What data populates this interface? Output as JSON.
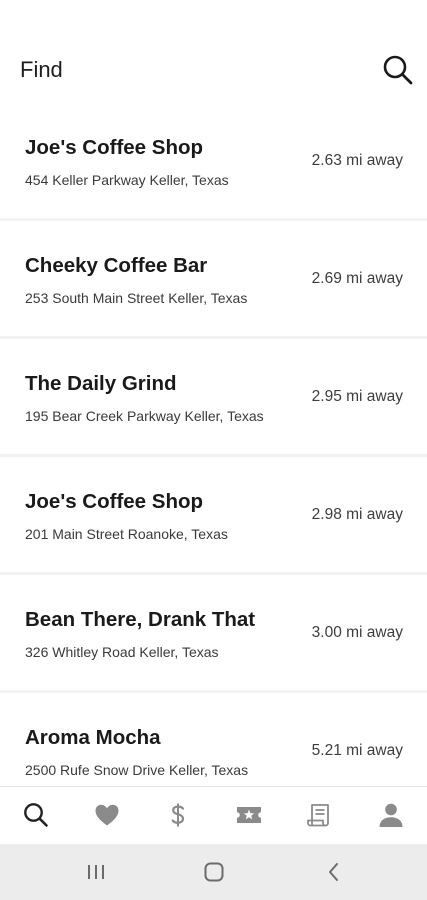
{
  "header": {
    "title": "Find",
    "search_icon": "search-icon"
  },
  "shops": [
    {
      "name": "Joe's Coffee Shop",
      "address": "454 Keller Parkway Keller, Texas",
      "distance": "2.63 mi away"
    },
    {
      "name": "Cheeky Coffee Bar",
      "address": "253 South Main Street Keller, Texas",
      "distance": "2.69 mi away"
    },
    {
      "name": "The Daily Grind",
      "address": "195 Bear Creek Parkway Keller, Texas",
      "distance": "2.95 mi away"
    },
    {
      "name": "Joe's Coffee Shop",
      "address": "201 Main Street Roanoke, Texas",
      "distance": "2.98 mi away"
    },
    {
      "name": "Bean There, Drank That",
      "address": "326 Whitley Road Keller, Texas",
      "distance": "3.00 mi away"
    },
    {
      "name": "Aroma Mocha",
      "address": "2500 Rufe Snow Drive Keller, Texas",
      "distance": "5.21 mi away"
    }
  ],
  "tabs": [
    {
      "icon": "search-icon",
      "active": true
    },
    {
      "icon": "heart-icon",
      "active": false
    },
    {
      "icon": "dollar-icon",
      "active": false
    },
    {
      "icon": "ticket-icon",
      "active": false
    },
    {
      "icon": "receipt-icon",
      "active": false
    },
    {
      "icon": "person-icon",
      "active": false
    }
  ],
  "system_nav": [
    "recents-icon",
    "home-icon",
    "back-icon"
  ],
  "colors": {
    "active_icon": "#222222",
    "inactive_icon": "#8a8a8a",
    "divider": "#f2f2f2",
    "system_bar": "#ececec"
  }
}
